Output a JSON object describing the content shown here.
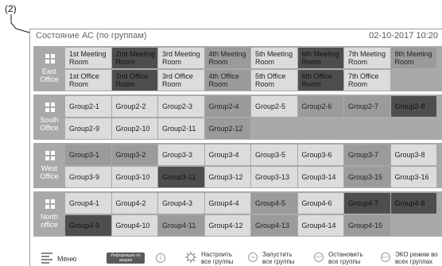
{
  "callout_label": "(2)",
  "header": {
    "title": "Состояние АС (по группам)",
    "datetime": "02-10-2017  10:20"
  },
  "groups": [
    {
      "name": "East Office",
      "rows": [
        [
          {
            "label": "1st Meeting Room",
            "state": "light"
          },
          {
            "label": "2nd Meeting Room",
            "state": "dark"
          },
          {
            "label": "3rd Meeting Room",
            "state": "light"
          },
          {
            "label": "4th Meeting Room",
            "state": "mid"
          },
          {
            "label": "5th Meeting Room",
            "state": "light"
          },
          {
            "label": "6th Meeting Room",
            "state": "dark"
          },
          {
            "label": "7th Meeting Room",
            "state": "light"
          },
          {
            "label": "8th Meeting Room",
            "state": "mid"
          }
        ],
        [
          {
            "label": "1st Office Room",
            "state": "light"
          },
          {
            "label": "2nd Office Room",
            "state": "dark"
          },
          {
            "label": "3rd Office Room",
            "state": "light"
          },
          {
            "label": "4th Office Room",
            "state": "mid"
          },
          {
            "label": "5th Office Room",
            "state": "light"
          },
          {
            "label": "6th Office Room",
            "state": "dark"
          },
          {
            "label": "7th Office Room",
            "state": "light"
          }
        ]
      ]
    },
    {
      "name": "South Office",
      "rows": [
        [
          {
            "label": "Group2-1",
            "state": "light"
          },
          {
            "label": "Group2-2",
            "state": "light"
          },
          {
            "label": "Group2-3",
            "state": "light"
          },
          {
            "label": "Group2-4",
            "state": "mid"
          },
          {
            "label": "Group2-5",
            "state": "light"
          },
          {
            "label": "Group2-6",
            "state": "mid"
          },
          {
            "label": "Group2-7",
            "state": "mid"
          },
          {
            "label": "Group2-8",
            "state": "dark"
          }
        ],
        [
          {
            "label": "Group2-9",
            "state": "light"
          },
          {
            "label": "Group2-10",
            "state": "light"
          },
          {
            "label": "Group2-11",
            "state": "light"
          },
          {
            "label": "Group2-12",
            "state": "mid"
          }
        ]
      ]
    },
    {
      "name": "West Office",
      "rows": [
        [
          {
            "label": "Group3-1",
            "state": "mid"
          },
          {
            "label": "Group3-2",
            "state": "mid"
          },
          {
            "label": "Group3-3",
            "state": "light"
          },
          {
            "label": "Group3-4",
            "state": "light"
          },
          {
            "label": "Group3-5",
            "state": "light"
          },
          {
            "label": "Group3-6",
            "state": "light"
          },
          {
            "label": "Group3-7",
            "state": "mid"
          },
          {
            "label": "Group3-8",
            "state": "light"
          }
        ],
        [
          {
            "label": "Group3-9",
            "state": "light"
          },
          {
            "label": "Group3-10",
            "state": "light"
          },
          {
            "label": "Group3-11",
            "state": "dark"
          },
          {
            "label": "Group3-12",
            "state": "light"
          },
          {
            "label": "Group3-13",
            "state": "light"
          },
          {
            "label": "Group3-14",
            "state": "light"
          },
          {
            "label": "Group3-15",
            "state": "mid"
          },
          {
            "label": "Group3-16",
            "state": "light"
          }
        ]
      ]
    },
    {
      "name": "North office",
      "rows": [
        [
          {
            "label": "Group4-1",
            "state": "light"
          },
          {
            "label": "Group4-2",
            "state": "light"
          },
          {
            "label": "Group4-3",
            "state": "light"
          },
          {
            "label": "Group4-4",
            "state": "light"
          },
          {
            "label": "Group4-5",
            "state": "mid"
          },
          {
            "label": "Group4-6",
            "state": "light"
          },
          {
            "label": "Group4-7",
            "state": "dark"
          },
          {
            "label": "Group4-8",
            "state": "dark"
          }
        ],
        [
          {
            "label": "Group4-9",
            "state": "dark"
          },
          {
            "label": "Group4-10",
            "state": "light"
          },
          {
            "label": "Group4-11",
            "state": "mid"
          },
          {
            "label": "Group4-12",
            "state": "light"
          },
          {
            "label": "Group4-13",
            "state": "mid"
          },
          {
            "label": "Group4-14",
            "state": "light"
          },
          {
            "label": "Group4-15",
            "state": "mid"
          }
        ]
      ]
    }
  ],
  "footer": {
    "menu_label": "Меню",
    "info_button": "Информация по аварии",
    "info_icon": "info-icon",
    "configure_all": "Настроить все группы",
    "start_all": "Запустить все группы",
    "stop_all": "Остановить все группы",
    "eco_all": "ЭКО режим во всех группах",
    "on_icon_text": "ON",
    "off_icon_text": "OFF",
    "eco_icon_text": "ECO"
  },
  "colors": {
    "light": "#dcdcdc",
    "mid": "#9b9b9b",
    "dark": "#4e4e4e",
    "group_bg": "#a9a9a9"
  }
}
